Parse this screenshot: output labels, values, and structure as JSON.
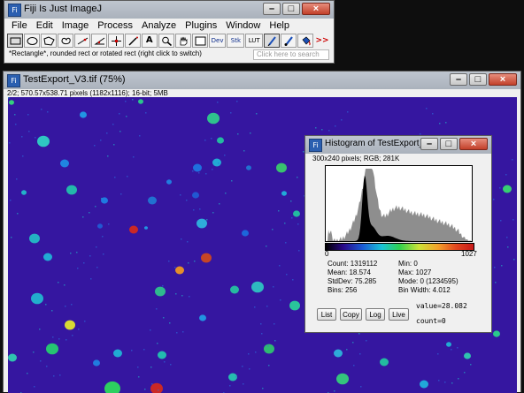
{
  "fiji": {
    "title": "Fiji Is Just ImageJ",
    "app_icon": "fiji-icon",
    "window_buttons": {
      "minimize": "–",
      "maximize": "□",
      "close": "×"
    },
    "menus": [
      "File",
      "Edit",
      "Image",
      "Process",
      "Analyze",
      "Plugins",
      "Window",
      "Help"
    ],
    "tools": [
      {
        "name": "rectangle-tool",
        "icon": "rectangle-icon",
        "label": ""
      },
      {
        "name": "oval-tool",
        "icon": "oval-icon",
        "label": ""
      },
      {
        "name": "polygon-tool",
        "icon": "polygon-icon",
        "label": ""
      },
      {
        "name": "freehand-tool",
        "icon": "freehand-icon",
        "label": ""
      },
      {
        "name": "line-tool",
        "icon": "line-icon",
        "label": ""
      },
      {
        "name": "angle-tool",
        "icon": "angle-icon",
        "label": ""
      },
      {
        "name": "point-tool",
        "icon": "crosshair-icon",
        "label": ""
      },
      {
        "name": "wand-tool",
        "icon": "wand-icon",
        "label": ""
      },
      {
        "name": "text-tool",
        "icon": "text-icon",
        "label": "A"
      },
      {
        "name": "zoom-tool",
        "icon": "magnifier-icon",
        "label": ""
      },
      {
        "name": "hand-tool",
        "icon": "hand-icon",
        "label": ""
      },
      {
        "name": "color-picker-tool",
        "icon": "square-icon",
        "label": ""
      },
      {
        "name": "dev-tool",
        "icon": "dev-icon",
        "label": "Dev"
      },
      {
        "name": "stack-tool",
        "icon": "stack-icon",
        "label": "Stk"
      },
      {
        "name": "lut-tool",
        "icon": "lut-icon",
        "label": "LUT"
      },
      {
        "name": "pencil-tool",
        "icon": "pencil-icon",
        "label": ""
      },
      {
        "name": "brush-tool",
        "icon": "brush-icon",
        "label": ""
      },
      {
        "name": "flood-fill-tool",
        "icon": "bucket-icon",
        "label": ""
      },
      {
        "name": "more-tools",
        "icon": "double-chevron-icon",
        "label": ">>"
      }
    ],
    "status": "*Rectangle*, rounded rect or rotated rect (right click to switch)",
    "search_placeholder": "Click here to search"
  },
  "image_window": {
    "title": "TestExport_V3.tif (75%)",
    "info": "2/2; 570.57x538.71 pixels (1182x1116); 16-bit; 5MB"
  },
  "histogram": {
    "title": "Histogram of TestExport_V3",
    "size_info": "300x240 pixels; RGB; 281K",
    "axis_min": "0",
    "axis_max": "1027",
    "stats_left": [
      "Count: 1319112",
      "Mean: 18.574",
      "StdDev: 75.285",
      "Bins: 256"
    ],
    "stats_right": [
      "Min: 0",
      "Max: 1027",
      "Mode: 0 (1234595)",
      "Bin Width: 4.012"
    ],
    "buttons": [
      "List",
      "Copy",
      "Log",
      "Live"
    ],
    "value_readout": "value=28.082",
    "count_readout": "count=0"
  },
  "colors": {
    "canvas_background": "#3516a0",
    "title_bar": "#b4bcc6",
    "close_button": "#c2402a"
  }
}
